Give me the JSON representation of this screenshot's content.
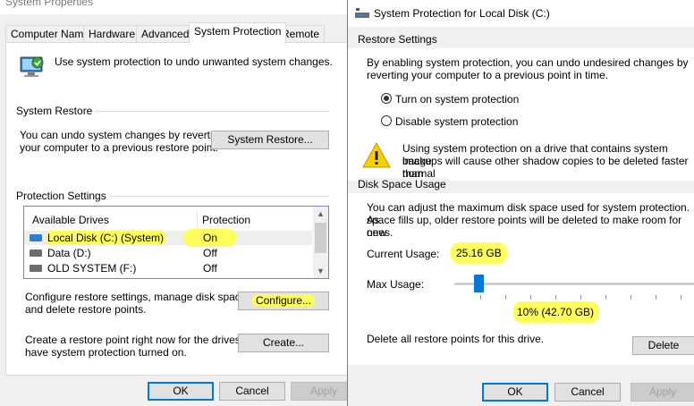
{
  "left_window": {
    "title": "System Properties",
    "tabs": [
      "Computer Name",
      "Hardware",
      "Advanced",
      "System Protection",
      "Remote"
    ],
    "intro_text": "Use system protection to undo unwanted system changes.",
    "system_restore": {
      "heading": "System Restore",
      "desc_line1": "You can undo system changes by reverting",
      "desc_line2": "your computer to a previous restore point.",
      "button": "System Restore..."
    },
    "protection_settings": {
      "heading": "Protection Settings",
      "columns": [
        "Available Drives",
        "Protection"
      ],
      "drives": [
        {
          "name": "Local Disk (C:) (System)",
          "protection": "On"
        },
        {
          "name": "Data (D:)",
          "protection": "Off"
        },
        {
          "name": "OLD SYSTEM (F:)",
          "protection": "Off"
        }
      ],
      "configure_line1": "Configure restore settings, manage disk space,",
      "configure_line2": "and delete restore points.",
      "configure_button": "Configure...",
      "create_line1": "Create a restore point right now for the drives that",
      "create_line2": "have system protection turned on.",
      "create_button": "Create..."
    },
    "buttons": {
      "ok": "OK",
      "cancel": "Cancel",
      "apply": "Apply"
    }
  },
  "right_window": {
    "title": "System Protection for Local Disk (C:)",
    "restore_settings": {
      "heading": "Restore Settings",
      "desc_line1": "By enabling system protection, you can undo undesired changes by",
      "desc_line2": "reverting your computer to a previous point in time.",
      "radio_on": "Turn on system protection",
      "radio_off": "Disable system protection",
      "selected": "on",
      "warning_line1": "Using system protection on a drive that contains system image",
      "warning_line2": "backups will cause other shadow copies to be deleted faster than",
      "warning_line3": "normal"
    },
    "disk_space": {
      "heading": "Disk Space Usage",
      "desc_line1": "You can adjust the maximum disk space used for system protection. As",
      "desc_line2": "space fills up, older restore points will be deleted to make room for new",
      "desc_line3": "ones.",
      "current_label": "Current Usage:",
      "current_value": "25.16 GB",
      "max_label": "Max Usage:",
      "max_percent": 10,
      "max_value": "10% (42.70 GB)",
      "delete_text": "Delete all restore points for this drive.",
      "delete_button": "Delete"
    },
    "buttons": {
      "ok": "OK",
      "cancel": "Cancel",
      "apply": "Apply"
    }
  },
  "colors": {
    "highlight": "#ffff5c",
    "accent": "#0078d7",
    "warning": "#f5d000"
  }
}
